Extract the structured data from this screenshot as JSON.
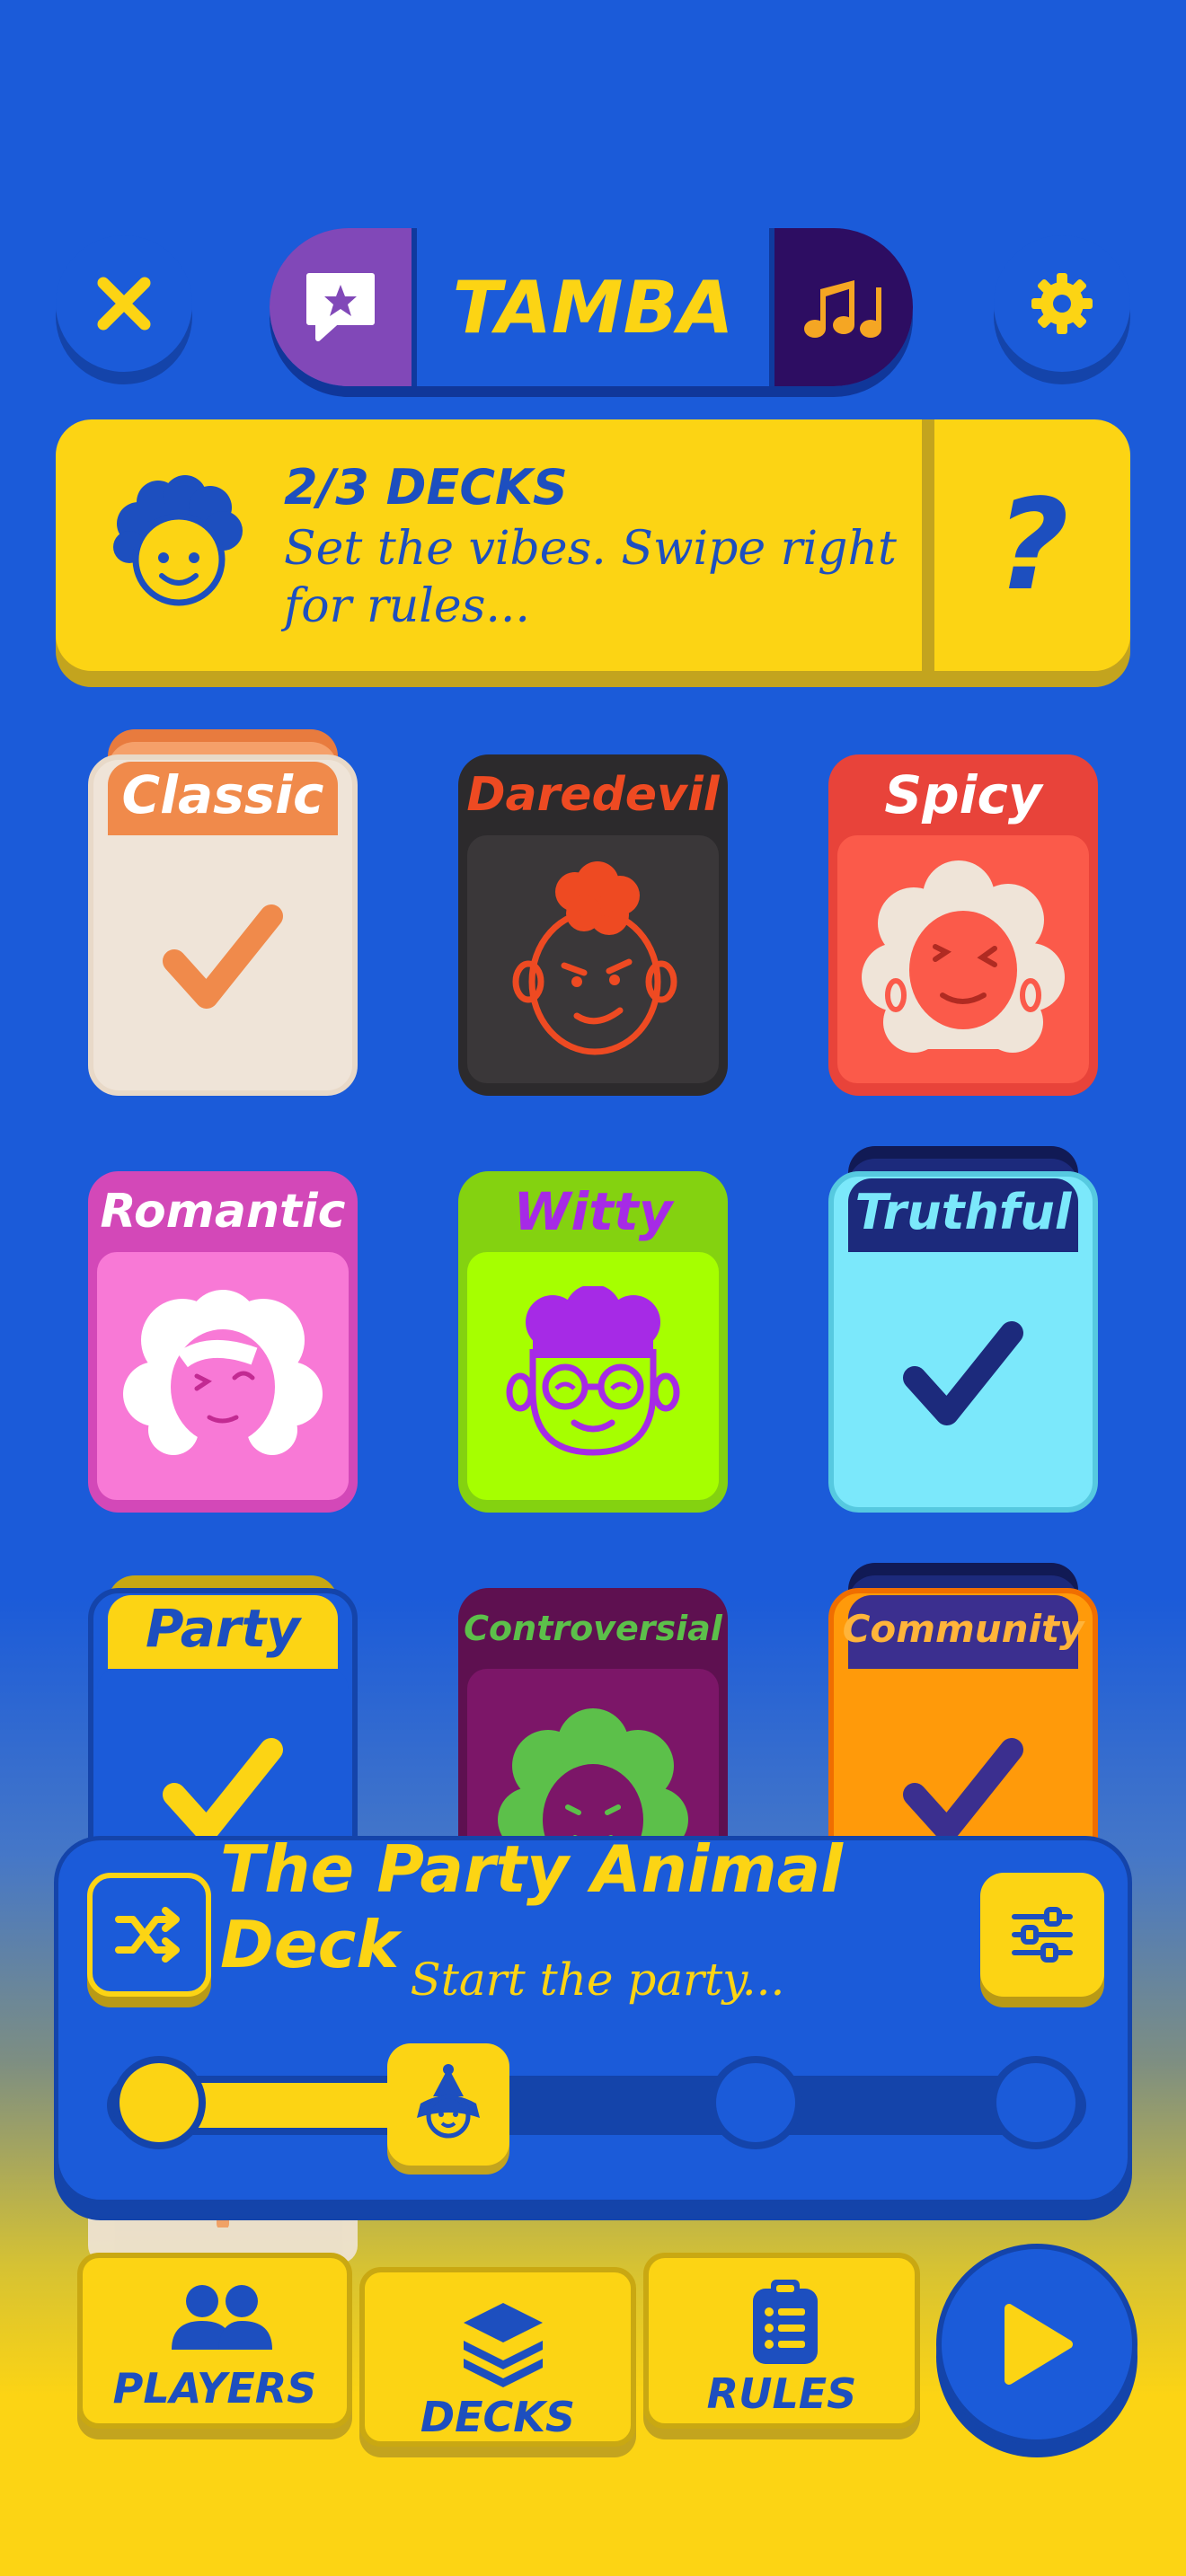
{
  "header": {
    "title": "TAMBA",
    "close_icon": "close-icon",
    "chat_icon": "chat-star-icon",
    "music_icon": "music-notes-icon",
    "settings_icon": "gear-icon"
  },
  "banner": {
    "count": "2/3 DECKS",
    "subtitle": "Set the vibes. Swipe right for rules...",
    "help": "?",
    "avatar_icon": "curly-hair-avatar-icon"
  },
  "decks": [
    {
      "name": "Classic",
      "selected": true,
      "color": "#f08a4b",
      "icon": "checkmark-icon"
    },
    {
      "name": "Daredevil",
      "selected": false,
      "color": "#ee4a22",
      "icon": "mohawk-face-icon"
    },
    {
      "name": "Spicy",
      "selected": false,
      "color": "#fb5a4a",
      "icon": "winking-face-icon"
    },
    {
      "name": "Romantic",
      "selected": false,
      "color": "#f879d6",
      "icon": "blushing-face-icon"
    },
    {
      "name": "Witty",
      "selected": false,
      "color": "#a6ff00",
      "icon": "glasses-face-icon"
    },
    {
      "name": "Truthful",
      "selected": true,
      "color": "#7be8fb",
      "icon": "checkmark-icon"
    },
    {
      "name": "Party",
      "selected": true,
      "color": "#1b5bd9",
      "icon": "checkmark-icon"
    },
    {
      "name": "Controversial",
      "selected": false,
      "color": "#7c1668",
      "icon": "curly-face-icon"
    },
    {
      "name": "Community",
      "selected": true,
      "color": "#ff9a0a",
      "icon": "checkmark-icon"
    }
  ],
  "deck_panel": {
    "title": "The Party Animal Deck",
    "subtitle": "Start the party...",
    "shuffle_icon": "shuffle-icon",
    "filter_icon": "sliders-icon",
    "slider_level": 0.33,
    "slider_steps": 4,
    "slider_thumb_icon": "party-hat-face-icon"
  },
  "nav": {
    "players": "PLAYERS",
    "decks": "DECKS",
    "rules": "RULES",
    "play_icon": "play-icon"
  }
}
